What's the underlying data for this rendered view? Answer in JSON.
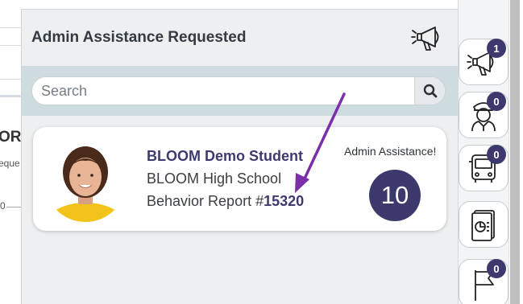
{
  "background": {
    "heading_fragment": "ORs",
    "sub_fragment": "eque",
    "tick_fragment": "0"
  },
  "panel": {
    "title": "Admin Assistance Requested",
    "header_icon": "megaphone-icon"
  },
  "search": {
    "placeholder": "Search",
    "value": "",
    "icon": "search-icon"
  },
  "notification": {
    "student_name": "BLOOM Demo Student",
    "school": "BLOOM High School",
    "report_prefix": "Behavior Report #",
    "report_number": "15320",
    "alert_type": "Admin Assistance!",
    "count": "10"
  },
  "sidebar": {
    "items": [
      {
        "icon": "megaphone-icon",
        "badge": "1"
      },
      {
        "icon": "officer-icon",
        "badge": "0"
      },
      {
        "icon": "bus-icon",
        "badge": "0"
      },
      {
        "icon": "report-chart-icon",
        "badge": ""
      },
      {
        "icon": "flag-icon",
        "badge": "0"
      }
    ]
  },
  "colors": {
    "accent": "#3c3a6d",
    "arrow": "#7b2fa8",
    "search_band": "#cfdcdf",
    "panel_bg": "#edeff1"
  }
}
